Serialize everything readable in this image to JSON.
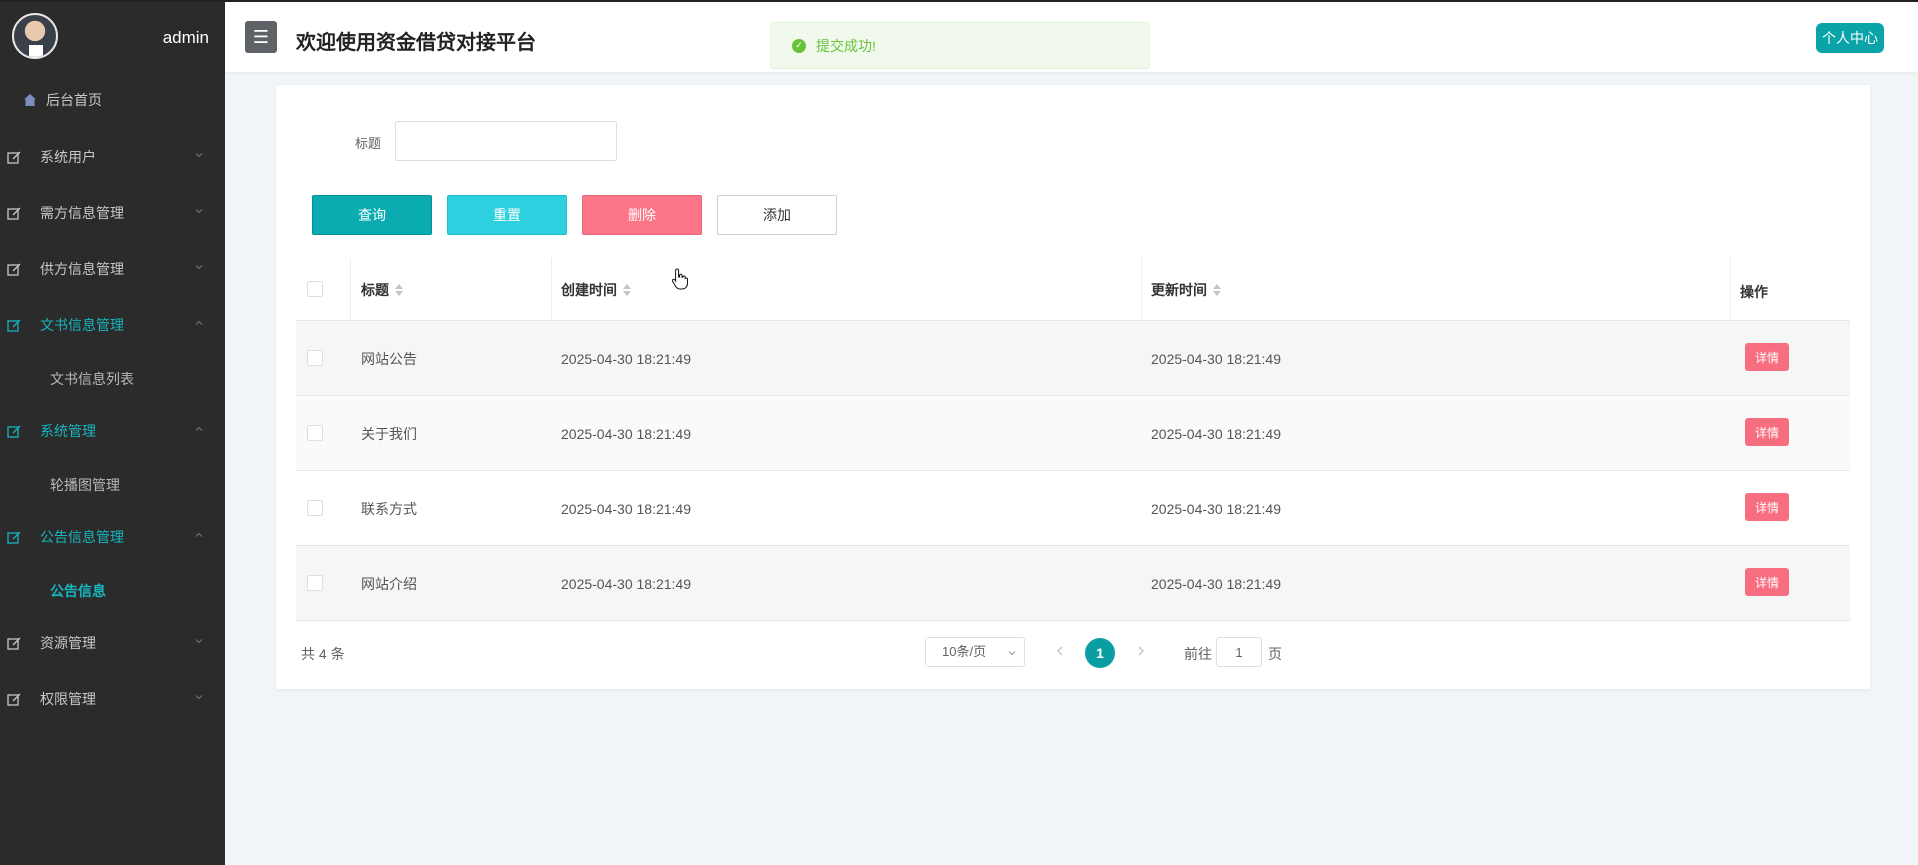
{
  "user": {
    "name": "admin"
  },
  "header": {
    "title": "欢迎使用资金借贷对接平台",
    "menu_icon": "☰",
    "user_center": "个人中心"
  },
  "toast": {
    "text": "提交成功!",
    "icon": "check-circle-icon"
  },
  "sidebar": {
    "home": "后台首页",
    "items": [
      {
        "label": "系统用户",
        "expanded": false
      },
      {
        "label": "需方信息管理",
        "expanded": false
      },
      {
        "label": "供方信息管理",
        "expanded": false
      },
      {
        "label": "文书信息管理",
        "expanded": true,
        "active": true,
        "sub": [
          "文书信息列表"
        ]
      },
      {
        "label": "系统管理",
        "expanded": true,
        "active": true,
        "sub": [
          "轮播图管理"
        ]
      },
      {
        "label": "公告信息管理",
        "expanded": true,
        "active": true,
        "sub": [
          "公告信息"
        ]
      },
      {
        "label": "资源管理",
        "expanded": false
      },
      {
        "label": "权限管理",
        "expanded": false
      }
    ],
    "accent_color": "#16b6bd"
  },
  "search": {
    "label": "标题",
    "value": ""
  },
  "buttons": {
    "query": "查询",
    "reset": "重置",
    "delete": "删除",
    "add": "添加"
  },
  "table": {
    "headers": {
      "title": "标题",
      "created": "创建时间",
      "updated": "更新时间",
      "actions": "操作"
    },
    "rows": [
      {
        "title": "网站公告",
        "created": "2025-04-30 18:21:49",
        "updated": "2025-04-30 18:21:49",
        "action": "详情"
      },
      {
        "title": "关于我们",
        "created": "2025-04-30 18:21:49",
        "updated": "2025-04-30 18:21:49",
        "action": "详情"
      },
      {
        "title": "联系方式",
        "created": "2025-04-30 18:21:49",
        "updated": "2025-04-30 18:21:49",
        "action": "详情"
      },
      {
        "title": "网站介绍",
        "created": "2025-04-30 18:21:49",
        "updated": "2025-04-30 18:21:49",
        "action": "详情"
      }
    ]
  },
  "pagination": {
    "total": "共 4 条",
    "page_size": "10条/页",
    "current": "1",
    "goto_prefix": "前往",
    "goto_value": "1",
    "goto_suffix": "页"
  },
  "colors": {
    "primary": "#0aacb1",
    "danger": "#fb7587",
    "info": "#2dd0de",
    "sidebar_bg": "#2b2b2b"
  }
}
